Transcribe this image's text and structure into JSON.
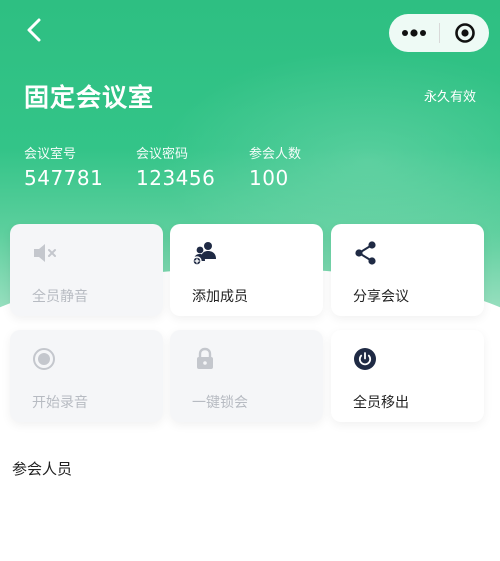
{
  "header": {
    "room_title": "固定会议室",
    "validity": "永久有效"
  },
  "stats": [
    {
      "label": "会议室号",
      "value": "547781"
    },
    {
      "label": "会议密码",
      "value": "123456"
    },
    {
      "label": "参会人数",
      "value": "100"
    }
  ],
  "actions": [
    {
      "label": "全员静音",
      "icon": "mute-icon",
      "enabled": false
    },
    {
      "label": "添加成员",
      "icon": "add-members-icon",
      "enabled": true
    },
    {
      "label": "分享会议",
      "icon": "share-icon",
      "enabled": true
    },
    {
      "label": "开始录音",
      "icon": "record-icon",
      "enabled": false
    },
    {
      "label": "一键锁会",
      "icon": "lock-icon",
      "enabled": false
    },
    {
      "label": "全员移出",
      "icon": "power-icon",
      "enabled": true
    }
  ],
  "participants": {
    "section_title": "参会人员"
  },
  "colors": {
    "brand_green": "#2ebf82",
    "disabled_text": "#b7bbc2",
    "icon_dark": "#1f2a44",
    "disabled_icon": "#c4c7cd"
  }
}
